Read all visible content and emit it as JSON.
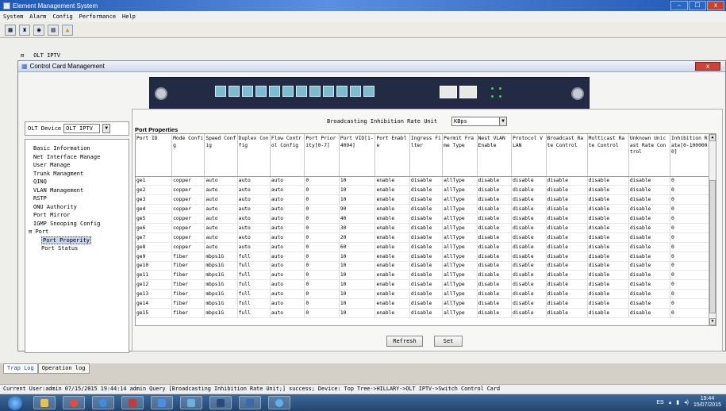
{
  "window": {
    "title": "Element Management System",
    "min": "–",
    "max": "☐",
    "close": "x"
  },
  "menu": [
    "System",
    "Alarm",
    "Config",
    "Performance",
    "Help"
  ],
  "toolbar_icons": [
    "network-icon",
    "topology-icon",
    "search-icon",
    "config-icon",
    "alarm-icon"
  ],
  "tree_root": {
    "tag": "",
    "label": "OLT IPTV"
  },
  "dialog": {
    "title": "Control Card Management",
    "close": "x"
  },
  "olt": {
    "label": "OLT Device",
    "value": "OLT IPTV"
  },
  "nav": [
    {
      "label": "Basic Information",
      "level": "item"
    },
    {
      "label": "Net Interface Manage",
      "level": "item"
    },
    {
      "label": "User Manage",
      "level": "item"
    },
    {
      "label": "Trunk Managment",
      "level": "item"
    },
    {
      "label": "QINQ",
      "level": "item"
    },
    {
      "label": "VLAN Management",
      "level": "item"
    },
    {
      "label": "RSTP",
      "level": "item"
    },
    {
      "label": "ONU Authority",
      "level": "item"
    },
    {
      "label": "Port Mirror",
      "level": "item"
    },
    {
      "label": "IGMP Snooping Config",
      "level": "item"
    },
    {
      "label": "Port",
      "level": "group"
    },
    {
      "label": "Port Properity",
      "level": "child",
      "selected": true
    },
    {
      "label": "Port Status",
      "level": "child"
    }
  ],
  "panel": {
    "title": "Port Properties",
    "rate_label": "Broadcasting Inhibition Rate Unit",
    "rate_value": "KBps",
    "refresh": "Refresh",
    "set": "Set"
  },
  "columns": [
    "Port ID",
    "Mode Config",
    "Speed Config",
    "Duplex Config",
    "Flow Control Config",
    "Port Priority[0-7]",
    "Port VID[1-4094]",
    "Port Enable",
    "Ingress Filter",
    "Permit Frame Type",
    "Nest VLAN Enable",
    "Protocol VLAN",
    "Broadcast Rate Control",
    "Multicast Rate Control",
    "Unknown Unicast Rate Control",
    "Inhibition Rate[0-1000000]"
  ],
  "rows": [
    [
      "ge1",
      "copper",
      "auto",
      "auto",
      "auto",
      "0",
      "10",
      "enable",
      "disable",
      "allType",
      "disable",
      "disable",
      "disable",
      "disable",
      "disable",
      "0"
    ],
    [
      "ge2",
      "copper",
      "auto",
      "auto",
      "auto",
      "0",
      "10",
      "enable",
      "disable",
      "allType",
      "disable",
      "disable",
      "disable",
      "disable",
      "disable",
      "0"
    ],
    [
      "ge3",
      "copper",
      "auto",
      "auto",
      "auto",
      "0",
      "10",
      "enable",
      "disable",
      "allType",
      "disable",
      "disable",
      "disable",
      "disable",
      "disable",
      "0"
    ],
    [
      "ge4",
      "copper",
      "auto",
      "auto",
      "auto",
      "0",
      "90",
      "enable",
      "disable",
      "allType",
      "disable",
      "disable",
      "disable",
      "disable",
      "disable",
      "0"
    ],
    [
      "ge5",
      "copper",
      "auto",
      "auto",
      "auto",
      "0",
      "40",
      "enable",
      "disable",
      "allType",
      "disable",
      "disable",
      "disable",
      "disable",
      "disable",
      "0"
    ],
    [
      "ge6",
      "copper",
      "auto",
      "auto",
      "auto",
      "0",
      "30",
      "enable",
      "disable",
      "allType",
      "disable",
      "disable",
      "disable",
      "disable",
      "disable",
      "0"
    ],
    [
      "ge7",
      "copper",
      "auto",
      "auto",
      "auto",
      "0",
      "20",
      "enable",
      "disable",
      "allType",
      "disable",
      "disable",
      "disable",
      "disable",
      "disable",
      "0"
    ],
    [
      "ge8",
      "copper",
      "auto",
      "auto",
      "auto",
      "0",
      "60",
      "enable",
      "disable",
      "allType",
      "disable",
      "disable",
      "disable",
      "disable",
      "disable",
      "0"
    ],
    [
      "ge9",
      "fiber",
      "mbps1G",
      "full",
      "auto",
      "0",
      "10",
      "enable",
      "disable",
      "allType",
      "disable",
      "disable",
      "disable",
      "disable",
      "disable",
      "0"
    ],
    [
      "ge10",
      "fiber",
      "mbps1G",
      "full",
      "auto",
      "0",
      "10",
      "enable",
      "disable",
      "allType",
      "disable",
      "disable",
      "disable",
      "disable",
      "disable",
      "0"
    ],
    [
      "ge11",
      "fiber",
      "mbps1G",
      "full",
      "auto",
      "0",
      "10",
      "enable",
      "disable",
      "allType",
      "disable",
      "disable",
      "disable",
      "disable",
      "disable",
      "0"
    ],
    [
      "ge12",
      "fiber",
      "mbps1G",
      "full",
      "auto",
      "0",
      "10",
      "enable",
      "disable",
      "allType",
      "disable",
      "disable",
      "disable",
      "disable",
      "disable",
      "0"
    ],
    [
      "ge13",
      "fiber",
      "mbps1G",
      "full",
      "auto",
      "0",
      "10",
      "enable",
      "disable",
      "allType",
      "disable",
      "disable",
      "disable",
      "disable",
      "disable",
      "0"
    ],
    [
      "ge14",
      "fiber",
      "mbps1G",
      "full",
      "auto",
      "0",
      "10",
      "enable",
      "disable",
      "allType",
      "disable",
      "disable",
      "disable",
      "disable",
      "disable",
      "0"
    ],
    [
      "ge15",
      "fiber",
      "mbps1G",
      "full",
      "auto",
      "0",
      "10",
      "enable",
      "disable",
      "allType",
      "disable",
      "disable",
      "disable",
      "disable",
      "disable",
      "0"
    ]
  ],
  "log_tabs": [
    "Trap Log",
    "Operation log"
  ],
  "status": "Current User:admin   07/15/2015 19:44:14  admin  Query [Broadcasting Inhibition Rate Unit;] success; Device: Top Tree->HILLARY->OLT IPTV->Switch Control Card",
  "tray": {
    "lang": "ES",
    "time": "19:44",
    "date": "15/07/2015"
  },
  "taskbar_apps": [
    "explorer-icon",
    "chrome-icon",
    "ie-icon",
    "app-icon",
    "app-icon",
    "app-icon",
    "app-icon",
    "app-icon",
    "app-icon",
    "app-icon"
  ],
  "colors": {
    "title_bar": "#1f57b5",
    "selection": "#c7d4ee",
    "taskbar": "#22456f"
  }
}
